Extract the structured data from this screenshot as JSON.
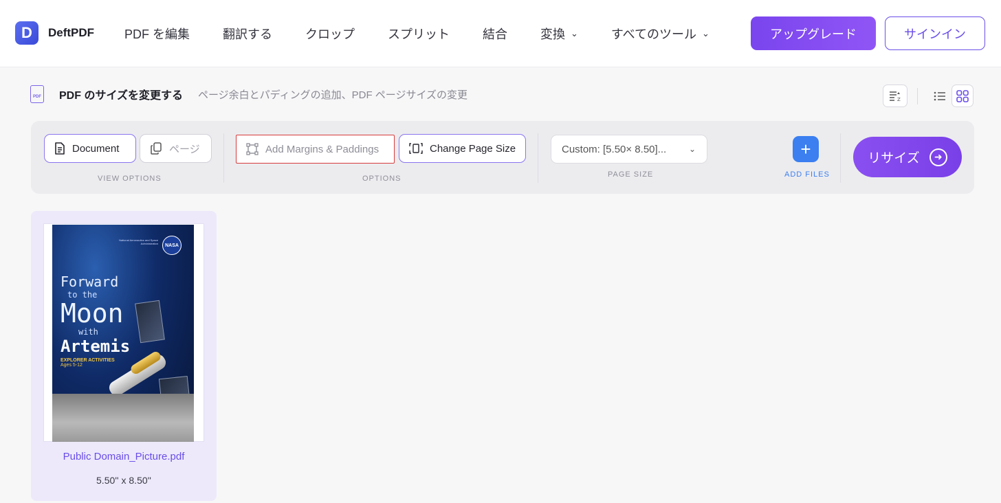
{
  "header": {
    "logo_letter": "D",
    "brand": "DeftPDF",
    "nav": [
      {
        "label": "PDF を編集",
        "dropdown": false
      },
      {
        "label": "翻訳する",
        "dropdown": false
      },
      {
        "label": "クロップ",
        "dropdown": false
      },
      {
        "label": "スプリット",
        "dropdown": false
      },
      {
        "label": "結合",
        "dropdown": false
      },
      {
        "label": "変換",
        "dropdown": true
      },
      {
        "label": "すべてのツール",
        "dropdown": true
      }
    ],
    "upgrade_label": "アップグレード",
    "signin_label": "サインイン"
  },
  "page": {
    "icon_label": "PDF",
    "title": "PDF のサイズを変更する",
    "subtitle": "ページ余白とパディングの追加、PDF ページサイズの変更"
  },
  "toolbar": {
    "view_options": {
      "document_label": "Document",
      "page_label": "ページ",
      "section_label": "VIEW OPTIONS",
      "selected": "Document"
    },
    "options": {
      "margins_label": "Add Margins & Paddings",
      "pagesize_label": "Change Page Size",
      "section_label": "OPTIONS"
    },
    "page_size": {
      "value": "Custom: [5.50× 8.50]...",
      "section_label": "PAGE SIZE"
    },
    "add_files_label": "ADD FILES",
    "resize_label": "リサイズ"
  },
  "files": [
    {
      "name": "Public Domain_Picture.pdf",
      "dimensions": "5.50'' x 8.50''",
      "cover": {
        "agency": "National Aeronautics and Space Administration",
        "logo": "NASA",
        "line1": "Forward",
        "line2": "to the",
        "line3": "Moon",
        "line4": "with",
        "line5": "Artemis",
        "line6": "EXPLORER ACTIVITIES",
        "line7": "Ages 5-12"
      }
    }
  ],
  "colors": {
    "accent": "#7a45ee",
    "accent_text": "#6a4de8",
    "add_button": "#3b7ff0",
    "highlight_border": "#d83a3a"
  }
}
